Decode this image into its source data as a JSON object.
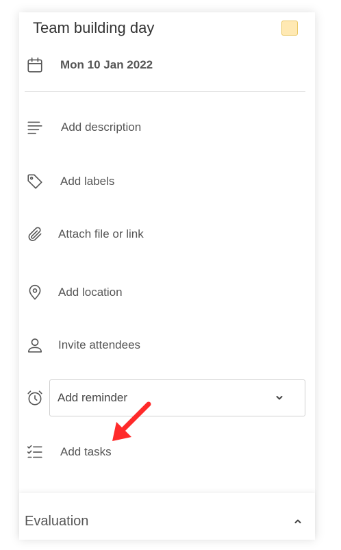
{
  "event": {
    "title": "Team building day",
    "color": "#ffe9b3",
    "date": "Mon 10 Jan 2022"
  },
  "actions": {
    "description": "Add description",
    "labels": "Add labels",
    "attach": "Attach file or link",
    "location": "Add location",
    "attendees": "Invite attendees",
    "tasks": "Add tasks"
  },
  "reminder": {
    "selected": "Add reminder"
  },
  "sections": {
    "evaluation": "Evaluation"
  },
  "colors": {
    "arrow": "#ff2a2a",
    "icon": "#555555"
  }
}
